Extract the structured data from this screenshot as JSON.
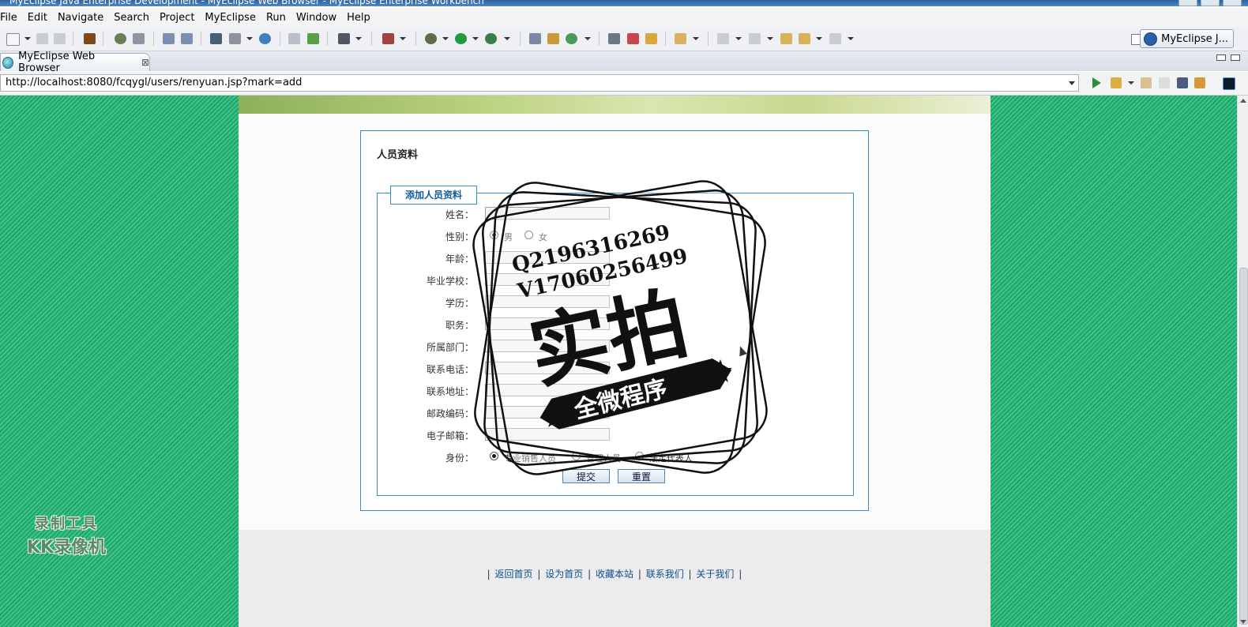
{
  "window": {
    "title": "MyEclipse Java Enterprise Development - MyEclipse Web Browser - MyEclipse Enterprise Workbench"
  },
  "menu": [
    "File",
    "Edit",
    "Navigate",
    "Search",
    "Project",
    "MyEclipse",
    "Run",
    "Window",
    "Help"
  ],
  "perspective": {
    "label": "MyEclipse J..."
  },
  "editor_tab": {
    "label": "MyEclipse Web Browser",
    "close": "⊠"
  },
  "address": {
    "url": "http://localhost:8080/fcqygl/users/renyuan.jsp?mark=add"
  },
  "form": {
    "panel_title": "人员资料",
    "legend": "添加人员资料",
    "fields": [
      {
        "label": "姓名：",
        "value": ""
      },
      {
        "label": "性别：",
        "value": ""
      },
      {
        "label": "年龄：",
        "value": ""
      },
      {
        "label": "毕业学校：",
        "value": ""
      },
      {
        "label": "学历：",
        "value": ""
      },
      {
        "label": "职务：",
        "value": ""
      },
      {
        "label": "所属部门：",
        "value": ""
      },
      {
        "label": "联系电话：",
        "value": ""
      },
      {
        "label": "联系地址：",
        "value": ""
      },
      {
        "label": "邮政编码：",
        "value": ""
      },
      {
        "label": "电子邮箱：",
        "value": ""
      },
      {
        "label": "身份：",
        "value": ""
      }
    ],
    "gender_options": [
      {
        "label": "男",
        "selected": true
      },
      {
        "label": "女",
        "selected": false
      }
    ],
    "identity_options": [
      {
        "label": "专业销售人员",
        "selected": true
      },
      {
        "label": "管理人员",
        "selected": false
      },
      {
        "label": "法定代表人",
        "selected": false
      }
    ],
    "submit_label": "提交",
    "reset_label": "重置"
  },
  "footer": {
    "links": [
      "返回首页",
      "设为首页",
      "收藏本站",
      "联系我们",
      "关于我们"
    ],
    "separator": "|"
  },
  "watermark": {
    "recorder_line1": "录制工具",
    "recorder_line2": "KK录像机",
    "stamp_q": "Q2196316269",
    "stamp_v": "V17060256499",
    "stamp_main": "实拍",
    "stamp_ribbon": "全微程序"
  },
  "colors": {
    "page_bg_green": "#1fa36a",
    "border_blue": "#2e8fc0",
    "legend_text": "#0e5f9c"
  }
}
